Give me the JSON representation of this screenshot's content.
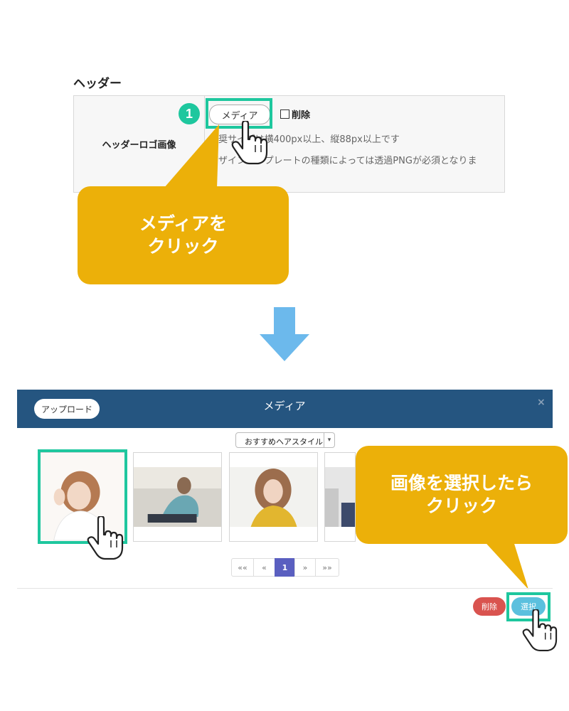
{
  "top": {
    "section_title": "ヘッダー",
    "field_label": "ヘッダーロゴ画像",
    "media_button": "メディア",
    "step_number": "1",
    "delete_label": "削除",
    "note_size": "推奨サイズは横400px以上、縦88px以上です",
    "note_template": "デザインテンプレートの種類によっては透過PNGが必須となりま",
    "callout_line1": "メディアを",
    "callout_line2": "クリック"
  },
  "modal": {
    "upload_button": "アップロード",
    "title": "メディア",
    "close": "×",
    "category_select": "おすすめヘアスタイル",
    "callout_line1": "画像を選択したら",
    "callout_line2": "クリック",
    "pagination": [
      "««",
      "«",
      "1",
      "»",
      "»»"
    ],
    "active_page": "1",
    "delete_button": "削除",
    "select_button": "選択"
  },
  "colors": {
    "highlight": "#1ec79e",
    "callout": "#ecb009",
    "modal_header": "#255580",
    "arrow": "#6cb9ec",
    "delete": "#d9534f",
    "select": "#5bc0de",
    "active_page": "#5a5fc0"
  },
  "icons": [
    "pointer-hand-icon",
    "down-arrow-icon",
    "close-icon",
    "chevron-down-icon"
  ]
}
